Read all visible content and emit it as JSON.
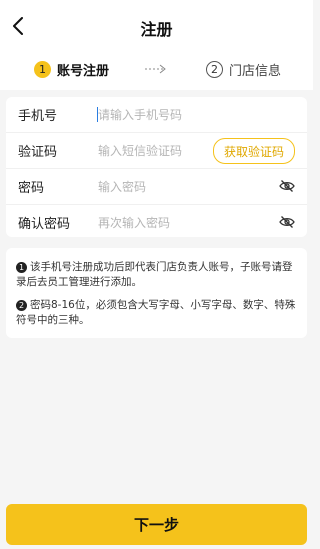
{
  "header": {
    "title": "注册",
    "back_icon": "chevron-left-icon"
  },
  "steps": [
    {
      "number": "1",
      "label": "账号注册",
      "active": true
    },
    {
      "number": "2",
      "label": "门店信息",
      "active": false
    }
  ],
  "form": {
    "phone": {
      "label": "手机号",
      "placeholder": "请输入手机号码",
      "value": ""
    },
    "code": {
      "label": "验证码",
      "placeholder": "输入短信验证码",
      "value": "",
      "button_label": "获取验证码"
    },
    "password": {
      "label": "密码",
      "placeholder": "输入密码",
      "value": "",
      "toggle_icon": "eye-off-icon"
    },
    "confirm": {
      "label": "确认密码",
      "placeholder": "再次输入密码",
      "value": "",
      "toggle_icon": "eye-off-icon"
    }
  },
  "notes": [
    {
      "badge": "1",
      "text": "该手机号注册成功后即代表门店负责人账号，子账号请登录后去员工管理进行添加。"
    },
    {
      "badge": "2",
      "text": "密码8-16位，必须包含大写字母、小写字母、数字、特殊符号中的三种。"
    }
  ],
  "footer": {
    "next_label": "下一步"
  },
  "colors": {
    "accent": "#f5c21b",
    "accent_text": "#e0a800",
    "background": "#f5f5f5"
  }
}
